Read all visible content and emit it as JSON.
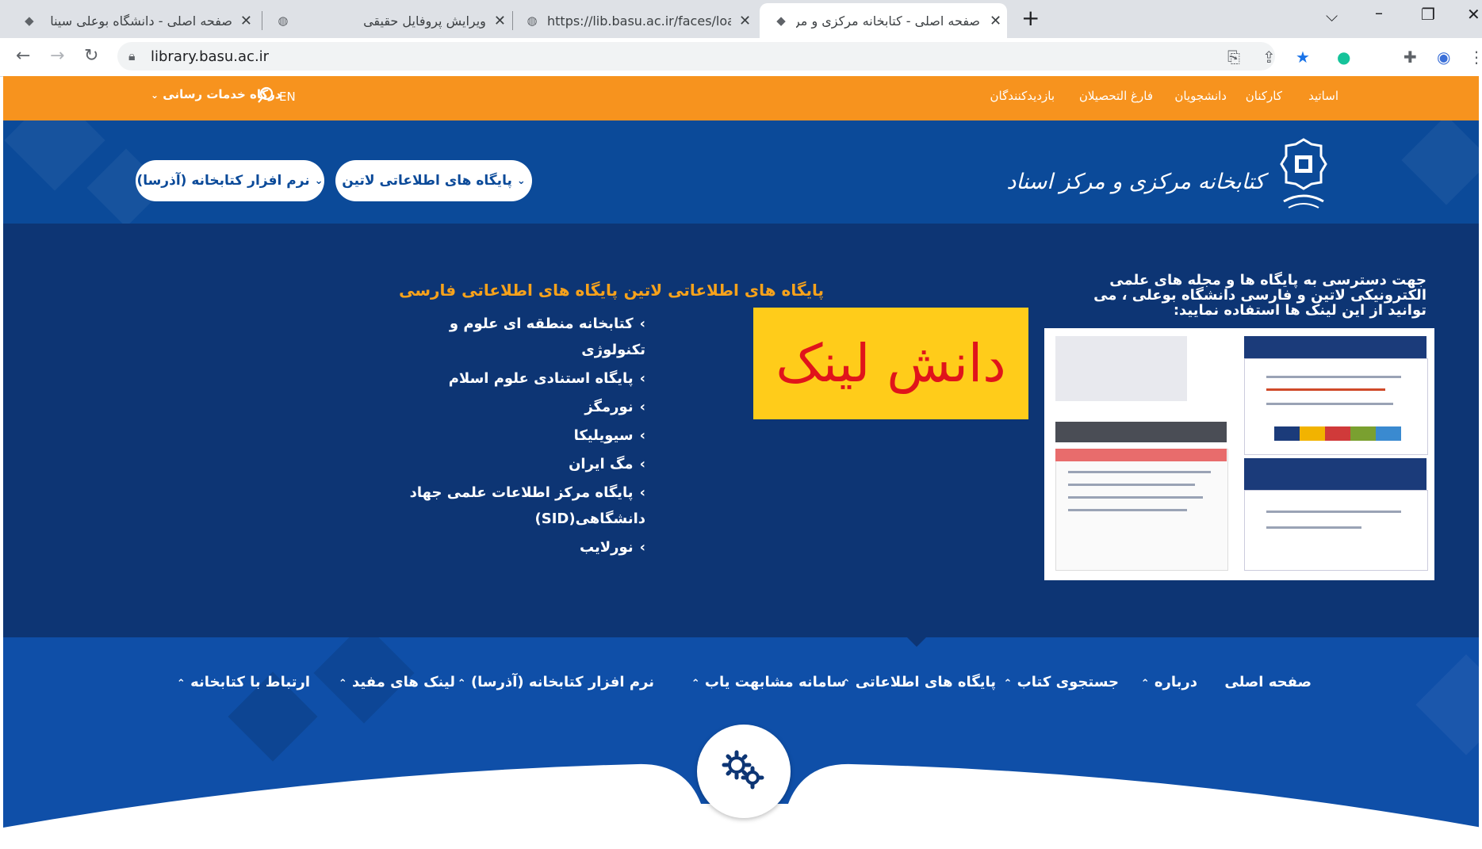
{
  "browser": {
    "tabs": [
      {
        "title": "صفحه اصلی - دانشگاه بوعلی سینا",
        "icon": "university-favicon-icon",
        "active": false
      },
      {
        "title": "ویرایش پروفایل حقیقی",
        "icon": "globe-icon",
        "active": false
      },
      {
        "title": "https://lib.basu.ac.ir/faces/loan/lo",
        "icon": "globe-icon",
        "active": false
      },
      {
        "title": "صفحه اصلی - کتابخانه مرکزی و مرکز",
        "icon": "university-favicon-icon",
        "active": true
      }
    ],
    "new_tab": "+",
    "url": "library.basu.ac.ir"
  },
  "site": {
    "topbar": {
      "links": [
        "اساتید",
        "کارکنان",
        "دانشجویان",
        "فارغ التحصیلان",
        "بازدیدکنندگان"
      ],
      "portal": "درگاه خدمات رسانی",
      "lang": "EN"
    },
    "header": {
      "logo_text": "کتابخانه مرکزی و مرکز اسناد",
      "buttons": [
        "پایگاه های اطلاعاتی لاتین",
        "نرم افزار کتابخانه (آذرسا)"
      ]
    },
    "main": {
      "intro": "جهت دسترسی به پایگاه ها و مجله های علمی الکترونیکی لاتین و فارسی دانشگاه بوعلی ، می توانید از این لینک ها استفاده نمایید:",
      "latin_title": "پایگاه های اطلاعاتی لاتین",
      "danesh_link": "دانش لینک",
      "farsi_title": "پایگاه های اطلاعاتی فارسی",
      "farsi_items": [
        "کتابخانه منطقه ای علوم و تکنولوژی",
        "پایگاه استنادی علوم اسلام",
        "نورمگز",
        "سیویلیکا",
        "مگ ایران",
        "پایگاه مرکز اطلاعات علمی جهاد دانشگاهی(SID)",
        "نورلایب"
      ]
    },
    "footer_nav": [
      "صفحه اصلی",
      "درباره",
      "جستجوی کتاب",
      "پایگاه های اطلاعاتی",
      "سامانه مشابهت یاب",
      "نرم افزار کتابخانه (آذرسا)",
      "لینک های مفید",
      "ارتباط با کتابخانه"
    ]
  },
  "colors": {
    "topbar": "#f7931e",
    "header": "#0b4a99",
    "main": "#0d3574",
    "title_accent": "#f7a21b",
    "danesh_bg": "#ffcc1a",
    "danesh_text": "#e0141b"
  }
}
